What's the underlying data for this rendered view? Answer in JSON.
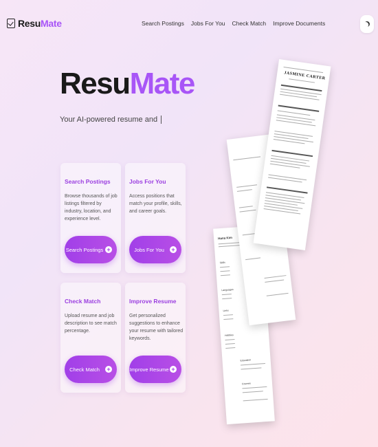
{
  "brand": {
    "part1": "Resu",
    "part2": "Mate"
  },
  "nav": [
    {
      "label": "Search Postings"
    },
    {
      "label": "Jobs For You"
    },
    {
      "label": "Check Match"
    },
    {
      "label": "Improve Documents"
    }
  ],
  "theme_icon": "moon-icon",
  "hero": {
    "title_part1": "Resu",
    "title_part2": "Mate",
    "subtitle": "Your AI-powered resume and"
  },
  "cards": [
    {
      "title": "Search Postings",
      "description": "Browse thousands of job listings filtered by industry, location, and experience level.",
      "button": "Search Postings",
      "button_icon": "plus-circle-icon"
    },
    {
      "title": "Jobs For You",
      "description": "Access positions that match your profile, skills, and career goals.",
      "button": "Jobs For You",
      "button_icon": "plus-circle-icon"
    },
    {
      "title": "Check Match",
      "description": "Upload resume and job description to see match percentage.",
      "button": "Check Match",
      "button_icon": "plus-circle-icon"
    },
    {
      "title": "Improve Resume",
      "description": "Get personalized suggestions to enhance your resume with tailored keywords.",
      "button": "Improve Resume",
      "button_icon": "plus-circle-icon"
    }
  ],
  "resumes": {
    "front_name": "JASMINE CARTER",
    "back_name": "Hana Kim",
    "back_sections": [
      "Skills",
      "Languages",
      "Links",
      "Hobbies",
      "Education",
      "Courses"
    ]
  },
  "colors": {
    "accent": "#a855f7",
    "button": "#a13fe8"
  }
}
